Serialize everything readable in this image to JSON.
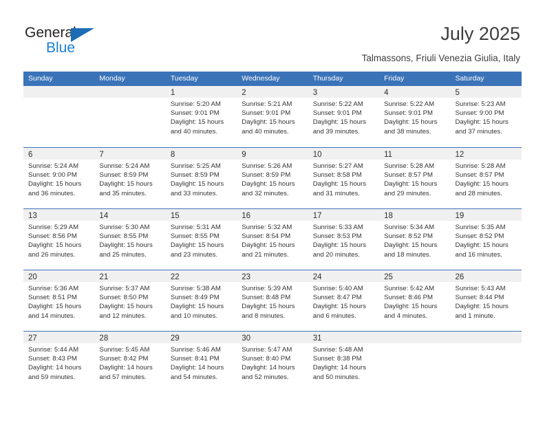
{
  "brand": {
    "name_dark": "General",
    "name_blue": "Blue",
    "accent_blue": "#1a7fd4",
    "triangle_blue": "#1a6db5"
  },
  "header": {
    "title": "July 2025",
    "subtitle": "Talmassons, Friuli Venezia Giulia, Italy",
    "header_bg": "#3b73b9",
    "header_text": "#ffffff"
  },
  "weekday_headers": [
    "Sunday",
    "Monday",
    "Tuesday",
    "Wednesday",
    "Thursday",
    "Friday",
    "Saturday"
  ],
  "weeks": [
    [
      {
        "day": "",
        "lines": []
      },
      {
        "day": "",
        "lines": []
      },
      {
        "day": "1",
        "lines": [
          "Sunrise: 5:20 AM",
          "Sunset: 9:01 PM",
          "Daylight: 15 hours",
          "and 40 minutes."
        ]
      },
      {
        "day": "2",
        "lines": [
          "Sunrise: 5:21 AM",
          "Sunset: 9:01 PM",
          "Daylight: 15 hours",
          "and 40 minutes."
        ]
      },
      {
        "day": "3",
        "lines": [
          "Sunrise: 5:22 AM",
          "Sunset: 9:01 PM",
          "Daylight: 15 hours",
          "and 39 minutes."
        ]
      },
      {
        "day": "4",
        "lines": [
          "Sunrise: 5:22 AM",
          "Sunset: 9:01 PM",
          "Daylight: 15 hours",
          "and 38 minutes."
        ]
      },
      {
        "day": "5",
        "lines": [
          "Sunrise: 5:23 AM",
          "Sunset: 9:00 PM",
          "Daylight: 15 hours",
          "and 37 minutes."
        ]
      }
    ],
    [
      {
        "day": "6",
        "lines": [
          "Sunrise: 5:24 AM",
          "Sunset: 9:00 PM",
          "Daylight: 15 hours",
          "and 36 minutes."
        ]
      },
      {
        "day": "7",
        "lines": [
          "Sunrise: 5:24 AM",
          "Sunset: 8:59 PM",
          "Daylight: 15 hours",
          "and 35 minutes."
        ]
      },
      {
        "day": "8",
        "lines": [
          "Sunrise: 5:25 AM",
          "Sunset: 8:59 PM",
          "Daylight: 15 hours",
          "and 33 minutes."
        ]
      },
      {
        "day": "9",
        "lines": [
          "Sunrise: 5:26 AM",
          "Sunset: 8:59 PM",
          "Daylight: 15 hours",
          "and 32 minutes."
        ]
      },
      {
        "day": "10",
        "lines": [
          "Sunrise: 5:27 AM",
          "Sunset: 8:58 PM",
          "Daylight: 15 hours",
          "and 31 minutes."
        ]
      },
      {
        "day": "11",
        "lines": [
          "Sunrise: 5:28 AM",
          "Sunset: 8:57 PM",
          "Daylight: 15 hours",
          "and 29 minutes."
        ]
      },
      {
        "day": "12",
        "lines": [
          "Sunrise: 5:28 AM",
          "Sunset: 8:57 PM",
          "Daylight: 15 hours",
          "and 28 minutes."
        ]
      }
    ],
    [
      {
        "day": "13",
        "lines": [
          "Sunrise: 5:29 AM",
          "Sunset: 8:56 PM",
          "Daylight: 15 hours",
          "and 26 minutes."
        ]
      },
      {
        "day": "14",
        "lines": [
          "Sunrise: 5:30 AM",
          "Sunset: 8:55 PM",
          "Daylight: 15 hours",
          "and 25 minutes."
        ]
      },
      {
        "day": "15",
        "lines": [
          "Sunrise: 5:31 AM",
          "Sunset: 8:55 PM",
          "Daylight: 15 hours",
          "and 23 minutes."
        ]
      },
      {
        "day": "16",
        "lines": [
          "Sunrise: 5:32 AM",
          "Sunset: 8:54 PM",
          "Daylight: 15 hours",
          "and 21 minutes."
        ]
      },
      {
        "day": "17",
        "lines": [
          "Sunrise: 5:33 AM",
          "Sunset: 8:53 PM",
          "Daylight: 15 hours",
          "and 20 minutes."
        ]
      },
      {
        "day": "18",
        "lines": [
          "Sunrise: 5:34 AM",
          "Sunset: 8:52 PM",
          "Daylight: 15 hours",
          "and 18 minutes."
        ]
      },
      {
        "day": "19",
        "lines": [
          "Sunrise: 5:35 AM",
          "Sunset: 8:52 PM",
          "Daylight: 15 hours",
          "and 16 minutes."
        ]
      }
    ],
    [
      {
        "day": "20",
        "lines": [
          "Sunrise: 5:36 AM",
          "Sunset: 8:51 PM",
          "Daylight: 15 hours",
          "and 14 minutes."
        ]
      },
      {
        "day": "21",
        "lines": [
          "Sunrise: 5:37 AM",
          "Sunset: 8:50 PM",
          "Daylight: 15 hours",
          "and 12 minutes."
        ]
      },
      {
        "day": "22",
        "lines": [
          "Sunrise: 5:38 AM",
          "Sunset: 8:49 PM",
          "Daylight: 15 hours",
          "and 10 minutes."
        ]
      },
      {
        "day": "23",
        "lines": [
          "Sunrise: 5:39 AM",
          "Sunset: 8:48 PM",
          "Daylight: 15 hours",
          "and 8 minutes."
        ]
      },
      {
        "day": "24",
        "lines": [
          "Sunrise: 5:40 AM",
          "Sunset: 8:47 PM",
          "Daylight: 15 hours",
          "and 6 minutes."
        ]
      },
      {
        "day": "25",
        "lines": [
          "Sunrise: 5:42 AM",
          "Sunset: 8:46 PM",
          "Daylight: 15 hours",
          "and 4 minutes."
        ]
      },
      {
        "day": "26",
        "lines": [
          "Sunrise: 5:43 AM",
          "Sunset: 8:44 PM",
          "Daylight: 15 hours",
          "and 1 minute."
        ]
      }
    ],
    [
      {
        "day": "27",
        "lines": [
          "Sunrise: 5:44 AM",
          "Sunset: 8:43 PM",
          "Daylight: 14 hours",
          "and 59 minutes."
        ]
      },
      {
        "day": "28",
        "lines": [
          "Sunrise: 5:45 AM",
          "Sunset: 8:42 PM",
          "Daylight: 14 hours",
          "and 57 minutes."
        ]
      },
      {
        "day": "29",
        "lines": [
          "Sunrise: 5:46 AM",
          "Sunset: 8:41 PM",
          "Daylight: 14 hours",
          "and 54 minutes."
        ]
      },
      {
        "day": "30",
        "lines": [
          "Sunrise: 5:47 AM",
          "Sunset: 8:40 PM",
          "Daylight: 14 hours",
          "and 52 minutes."
        ]
      },
      {
        "day": "31",
        "lines": [
          "Sunrise: 5:48 AM",
          "Sunset: 8:38 PM",
          "Daylight: 14 hours",
          "and 50 minutes."
        ]
      },
      {
        "day": "",
        "lines": []
      },
      {
        "day": "",
        "lines": []
      }
    ]
  ]
}
